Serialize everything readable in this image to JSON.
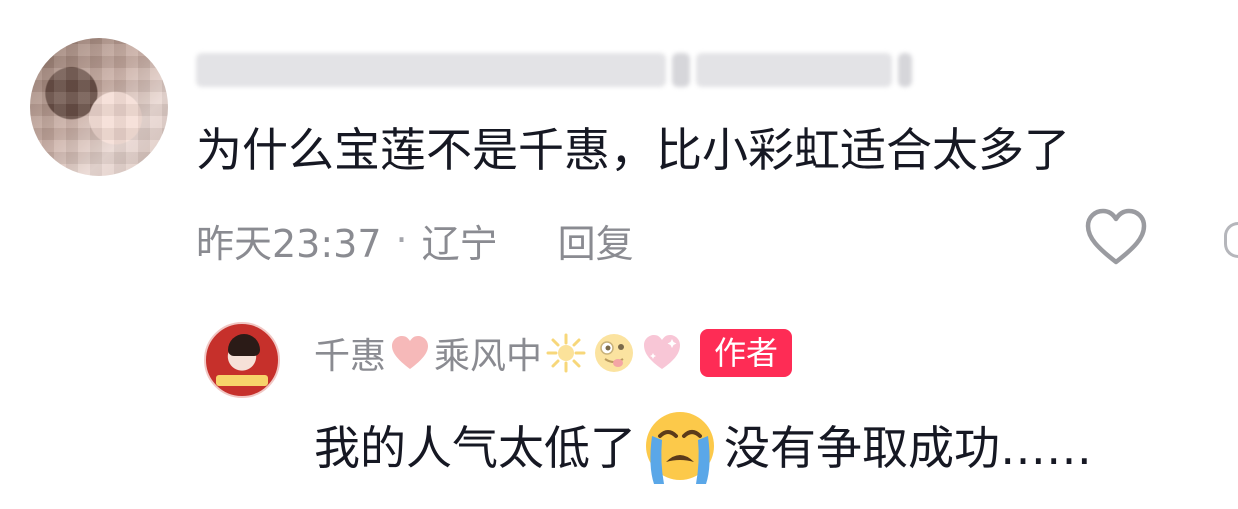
{
  "comment": {
    "text": "为什么宝莲不是千惠，比小彩虹适合太多了",
    "time": "昨天23:37",
    "separator": "·",
    "location": "辽宁",
    "reply_label": "回复",
    "icons": {
      "like": "heart-outline-icon"
    }
  },
  "reply": {
    "name_part1": "千惠",
    "name_part2": "乘风中",
    "author_badge": "作者",
    "text_before": "我的人气太低了",
    "text_after": "没有争取成功……",
    "icons": {
      "name_heart": "pink-heart-icon",
      "sparkle": "glowing-star-icon",
      "zany": "zany-face-icon",
      "sparkling_heart": "sparkling-heart-icon",
      "cry": "loudly-crying-face-icon"
    }
  },
  "colors": {
    "badge": "#fe2c55",
    "meta": "#8a8b91",
    "text": "#161823"
  }
}
